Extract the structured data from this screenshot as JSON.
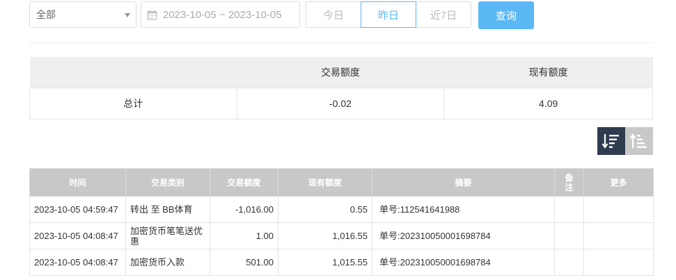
{
  "filters": {
    "category_value": "全部",
    "date_range": "2023-10-05 ~ 2023-10-05",
    "quick_ranges": [
      {
        "label": "今日",
        "active": false
      },
      {
        "label": "昨日",
        "active": true
      },
      {
        "label": "近7日",
        "active": false
      }
    ],
    "query_label": "查询"
  },
  "summary": {
    "headers": [
      "",
      "交易额度",
      "现有额度"
    ],
    "row": {
      "label": "总计",
      "trade_amount": "-0.02",
      "balance": "4.09"
    }
  },
  "sort": {
    "desc_icon": "sort-desc-icon",
    "asc_icon": "sort-asc-icon",
    "active_color": "#2f3c4f",
    "inactive_color": "#c8c8c8"
  },
  "records": {
    "headers": {
      "time": "时间",
      "type": "交易类别",
      "amount": "交易额度",
      "balance": "现有额度",
      "summary": "摘要",
      "note": "备注",
      "more": "更多"
    },
    "rows": [
      {
        "time": "2023-10-05 04:59:47",
        "type": "转出 至 BB体育",
        "amount": "-1,016.00",
        "balance": "0.55",
        "summary": "单号:112541641988",
        "note": "",
        "more": ""
      },
      {
        "time": "2023-10-05 04:08:47",
        "type": "加密货币笔笔送优惠",
        "amount": "1.00",
        "balance": "1,016.55",
        "summary": "单号:202310050001698784",
        "note": "",
        "more": ""
      },
      {
        "time": "2023-10-05 04:08:47",
        "type": "加密货币入款",
        "amount": "501.00",
        "balance": "1,015.55",
        "summary": "单号:202310050001698784",
        "note": "",
        "more": ""
      }
    ]
  },
  "colors": {
    "accent": "#5bb8f5",
    "table_header": "#c8c8c8",
    "summary_header": "#efefef"
  }
}
